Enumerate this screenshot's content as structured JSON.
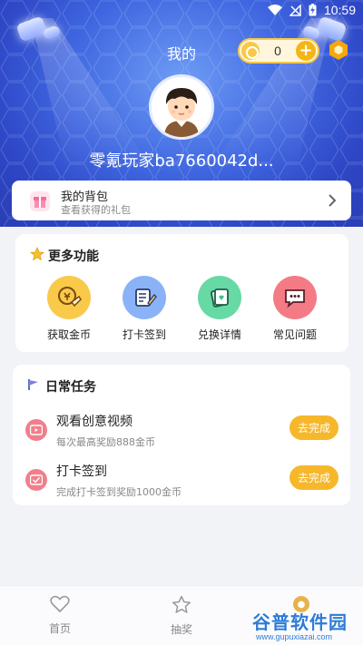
{
  "status_bar": {
    "time": "10:59"
  },
  "header": {
    "title": "我的",
    "coin_balance": "0",
    "username": "零氪玩家ba7660042d..."
  },
  "backpack": {
    "title": "我的背包",
    "subtitle": "查看获得的礼包"
  },
  "more_features": {
    "title": "更多功能",
    "items": [
      {
        "label": "获取金币",
        "icon": "coin-hand-icon",
        "color": "#f9c94a"
      },
      {
        "label": "打卡签到",
        "icon": "sign-in-icon",
        "color": "#8ab3f7"
      },
      {
        "label": "兑换详情",
        "icon": "exchange-icon",
        "color": "#66d9a5"
      },
      {
        "label": "常见问题",
        "icon": "faq-chat-icon",
        "color": "#f47b86"
      }
    ]
  },
  "daily_tasks": {
    "title": "日常任务",
    "tasks": [
      {
        "title": "观看创意视频",
        "subtitle": "每次最高奖励888金币",
        "button": "去完成",
        "icon": "video-icon"
      },
      {
        "title": "打卡签到",
        "subtitle": "完成打卡签到奖励1000金币",
        "button": "去完成",
        "icon": "checkin-icon"
      }
    ]
  },
  "bottom_nav": {
    "items": [
      {
        "label": "首页",
        "icon": "heart-icon"
      },
      {
        "label": "抽奖",
        "icon": "star-icon"
      }
    ]
  },
  "watermark": {
    "text": "谷普软件园",
    "url": "www.gupuxiazai.com"
  },
  "colors": {
    "header_blue": "#3f66e0",
    "accent_gold": "#f6b72b",
    "task_icon_pink": "#f07f8c"
  }
}
